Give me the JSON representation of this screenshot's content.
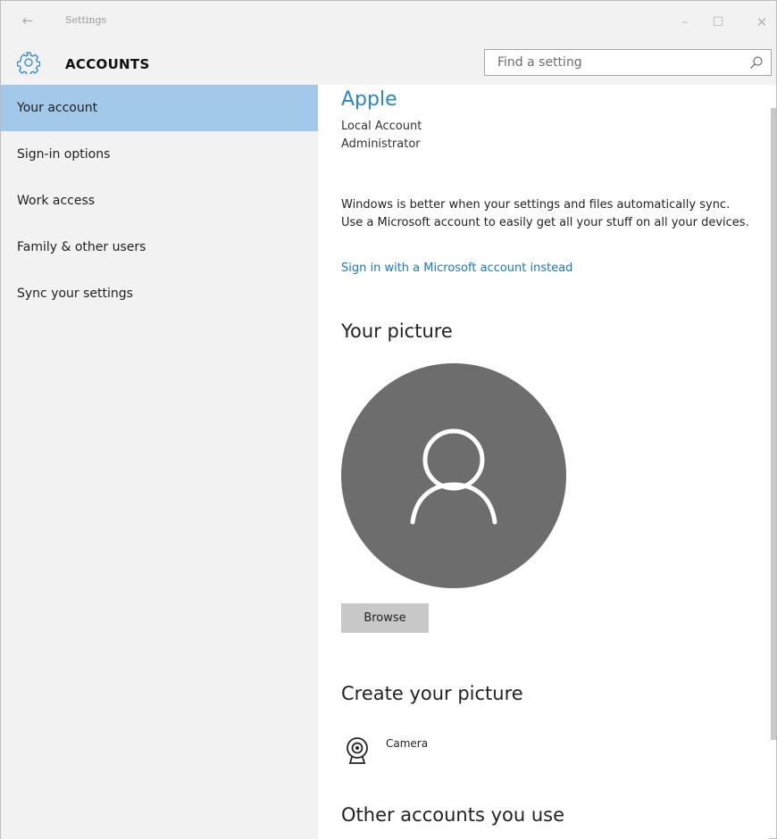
{
  "window": {
    "title": "Settings",
    "back_icon": "back-arrow-icon",
    "controls": {
      "minimize": "–",
      "maximize": "☐",
      "close": "✕"
    }
  },
  "header": {
    "app_title": "ACCOUNTS",
    "icon": "gear-icon",
    "search": {
      "placeholder": "Find a setting",
      "icon": "search-icon"
    }
  },
  "sidebar": {
    "items": [
      {
        "label": "Your account",
        "active": true
      },
      {
        "label": "Sign-in options",
        "active": false
      },
      {
        "label": "Work access",
        "active": false
      },
      {
        "label": "Family & other users",
        "active": false
      },
      {
        "label": "Sync your settings",
        "active": false
      }
    ]
  },
  "account": {
    "name": "Apple",
    "type": "Local Account",
    "role": "Administrator",
    "sync_text": "Windows is better when your settings and files automatically sync. Use a Microsoft account to easily get all your stuff on all your devices.",
    "ms_link": "Sign in with a Microsoft account instead"
  },
  "picture": {
    "heading": "Your picture",
    "avatar_icon": "user-silhouette-icon",
    "browse_label": "Browse"
  },
  "create": {
    "heading": "Create your picture",
    "camera_label": "Camera",
    "camera_icon": "camera-icon"
  },
  "other": {
    "heading": "Other accounts you use"
  },
  "colors": {
    "accent": "#2b86c8",
    "link": "#1777c8",
    "selection": "#a2c8ea",
    "chrome": "#f2f2f2",
    "avatar": "#6d6d6d"
  }
}
